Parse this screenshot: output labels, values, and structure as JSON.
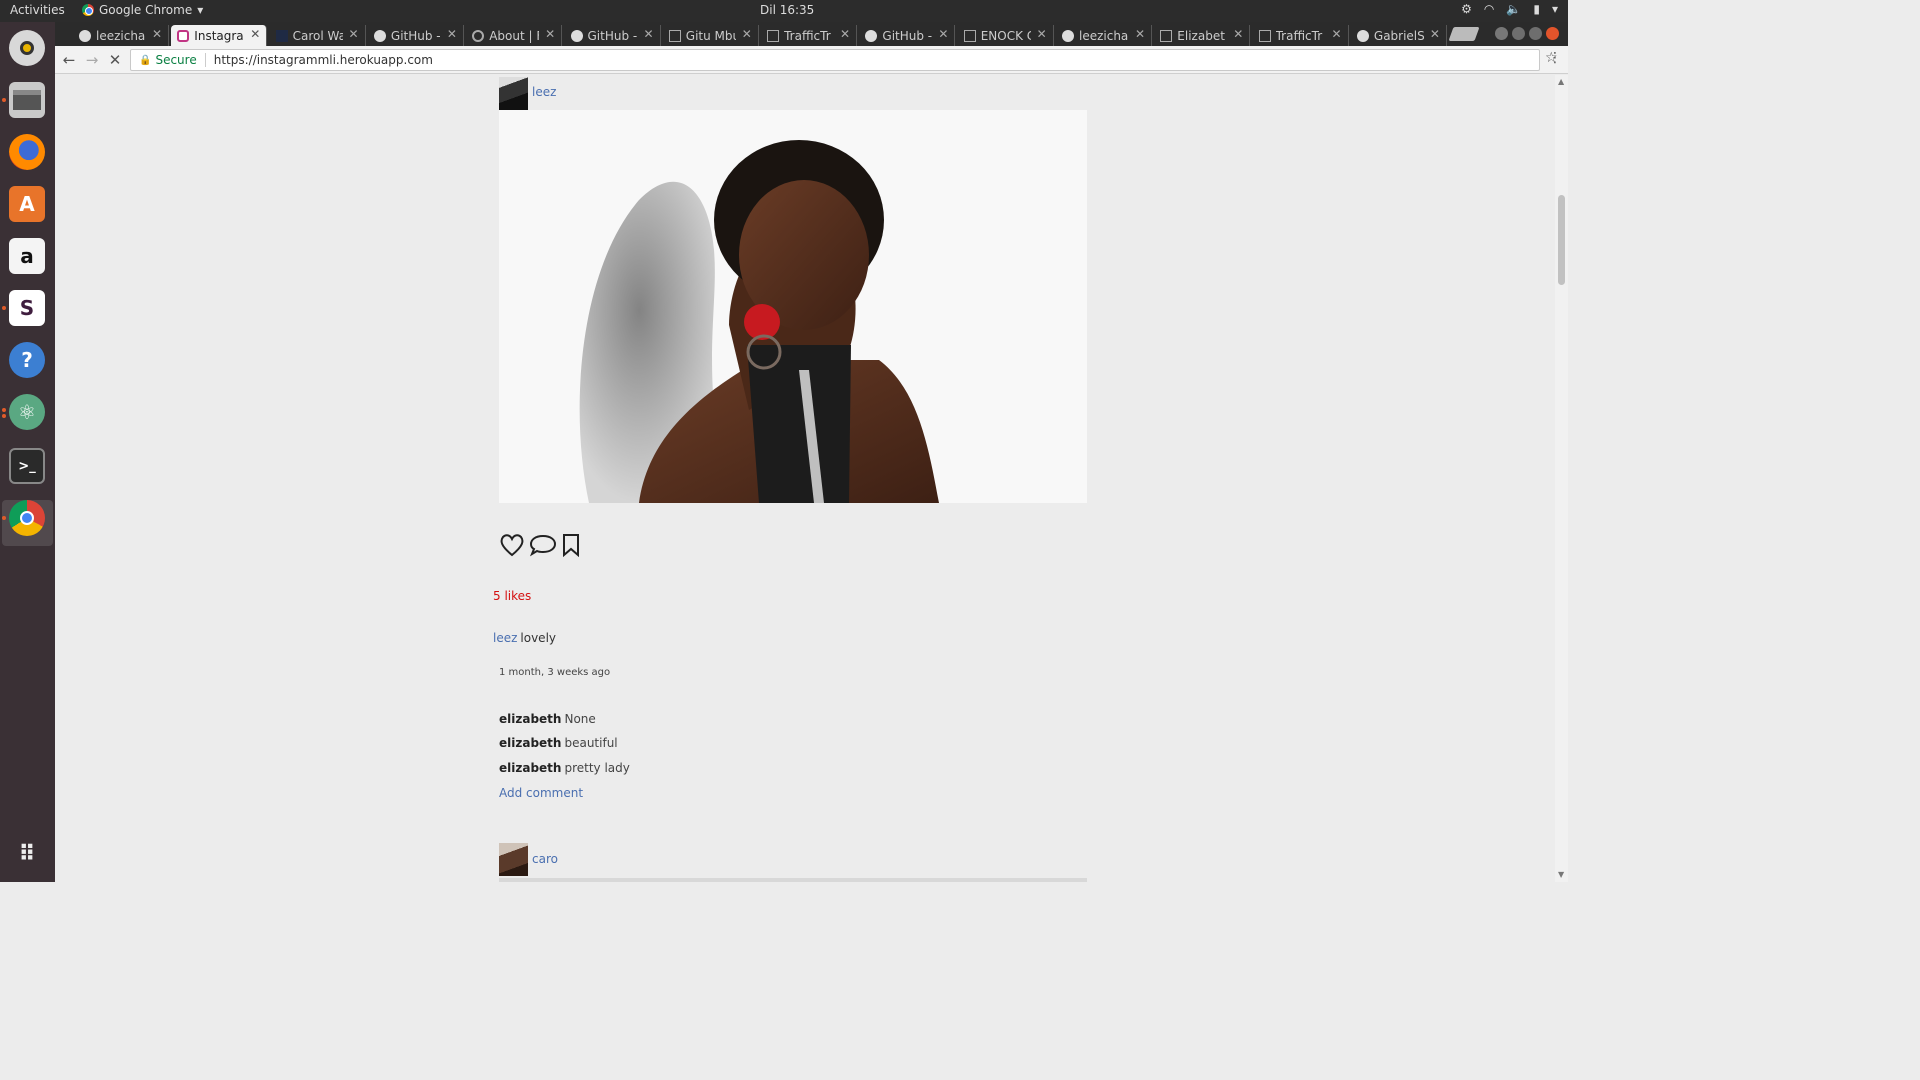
{
  "system": {
    "activities": "Activities",
    "app_name": "Google Chrome",
    "clock": "Dil 16:35"
  },
  "browser": {
    "tabs": [
      {
        "label": "leezichar",
        "icon": "github-icon"
      },
      {
        "label": "Instagra",
        "icon": "instagram-icon",
        "active": true
      },
      {
        "label": "Carol Wa",
        "icon": "page-icon"
      },
      {
        "label": "GitHub -",
        "icon": "github-icon"
      },
      {
        "label": "About | F",
        "icon": "user-icon"
      },
      {
        "label": "GitHub -",
        "icon": "github-icon"
      },
      {
        "label": "Gitu Mbu",
        "icon": "document-icon"
      },
      {
        "label": "TrafficTr",
        "icon": "document-icon"
      },
      {
        "label": "GitHub -",
        "icon": "github-icon"
      },
      {
        "label": "ENOCK C",
        "icon": "document-icon"
      },
      {
        "label": "leezichar",
        "icon": "github-icon"
      },
      {
        "label": "Elizabet",
        "icon": "document-icon"
      },
      {
        "label": "TrafficTr",
        "icon": "document-icon"
      },
      {
        "label": "GabrielS",
        "icon": "github-icon"
      }
    ],
    "secure_label": "Secure",
    "url": "https://instagrammli.herokuapp.com"
  },
  "post": {
    "author": "leez",
    "likes": "5 likes",
    "caption_user": "leez",
    "caption_text": "lovely",
    "timestamp": "1 month, 3 weeks ago",
    "comments": [
      {
        "user": "elizabeth",
        "text": "None"
      },
      {
        "user": "elizabeth",
        "text": "beautiful"
      },
      {
        "user": "elizabeth",
        "text": "pretty lady"
      }
    ],
    "add_comment": "Add comment"
  },
  "next_post": {
    "author": "caro"
  },
  "colors": {
    "link": "#4a6fb0",
    "likes": "#d40f0f",
    "secure": "#0b8043"
  }
}
